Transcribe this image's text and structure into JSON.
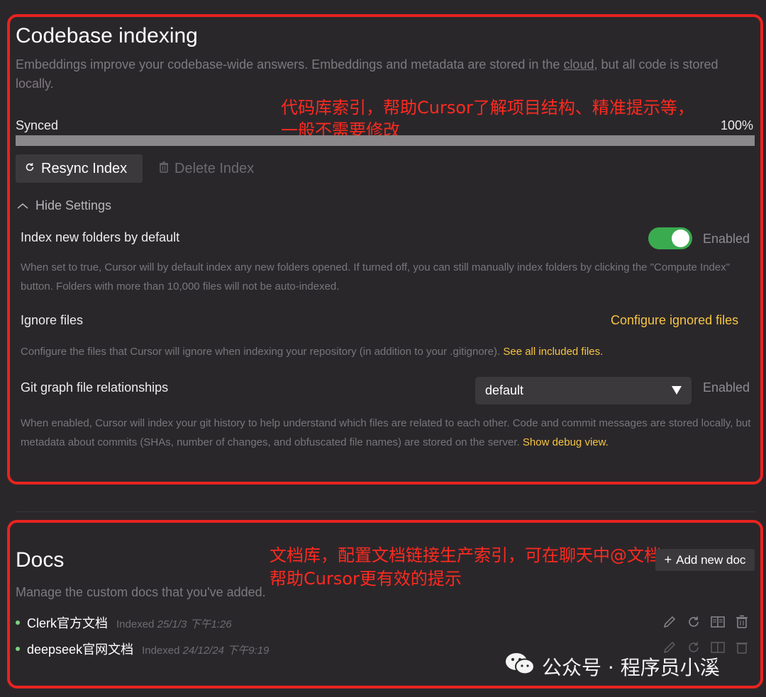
{
  "indexing": {
    "title": "Codebase indexing",
    "desc_before": "Embeddings improve your codebase-wide answers. Embeddings and metadata are stored in the ",
    "desc_link": "cloud",
    "desc_after": ", but all code is stored locally.",
    "status": "Synced",
    "progress_text": "100%",
    "progress": 1.0,
    "resync_label": "Resync Index",
    "delete_label": "Delete Index",
    "hide_settings_label": "Hide Settings",
    "new_folders": {
      "label": "Index new folders by default",
      "toggle_on": true,
      "status": "Enabled",
      "desc": "When set to true, Cursor will by default index any new folders opened. If turned off, you can still manually index folders by clicking the \"Compute Index\" button. Folders with more than 10,000 files will not be auto-indexed."
    },
    "ignore": {
      "label": "Ignore files",
      "action": "Configure ignored files",
      "desc": "Configure the files that Cursor will ignore when indexing your repository (in addition to your .gitignore). ",
      "desc_link": "See all included files."
    },
    "git_graph": {
      "label": "Git graph file relationships",
      "select_value": "default",
      "status": "Enabled",
      "desc": "When enabled, Cursor will index your git history to help understand which files are related to each other. Code and commit messages are stored locally, but metadata about commits (SHAs, number of changes, and obfuscated file names) are stored on the server. ",
      "desc_link": "Show debug view."
    }
  },
  "annotations": {
    "indexing_line1": "代码库索引，帮助Cursor了解项目结构、精准提示等，",
    "indexing_line2": "一般不需要修改",
    "docs_line1": "文档库，配置文档链接生产索引，可在聊天中@文档",
    "docs_line2": "帮助Cursor更有效的提示"
  },
  "docs": {
    "title": "Docs",
    "desc": "Manage the custom docs that you've added.",
    "add_label": "Add new doc",
    "items": [
      {
        "name": "Clerk官方文档",
        "indexed_label": "Indexed",
        "date": "25/1/3 下午1:26"
      },
      {
        "name": "deepseek官网文档",
        "indexed_label": "Indexed",
        "date": "24/12/24 下午9:19"
      }
    ]
  },
  "watermark": "公众号 · 程序员小溪",
  "colors": {
    "accent_link": "#f5c542",
    "toggle_on": "#3aab4f",
    "annotation": "#e8231f",
    "dot": "#7fd07f"
  },
  "icons": [
    "refresh-icon",
    "trash-icon",
    "chevron-up-icon",
    "dropdown-arrow-icon",
    "plus-icon",
    "edit-icon",
    "book-icon",
    "wechat-icon"
  ]
}
